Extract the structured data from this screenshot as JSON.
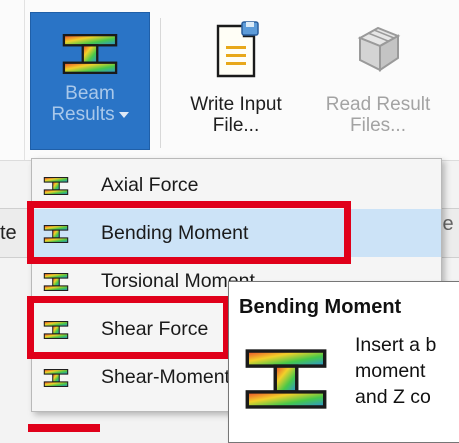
{
  "ribbon": {
    "beam_results": {
      "label": "Beam\nResults",
      "icon": "beam-results-icon"
    },
    "write_input": {
      "label": "Write Input\nFile...",
      "icon": "write-input-file-icon"
    },
    "read_result": {
      "label": "Read Result\nFiles...",
      "icon": "read-result-files-icon",
      "enabled": false
    }
  },
  "background": {
    "left_fragment": "te",
    "right_fragment": "le"
  },
  "menu": {
    "items": [
      {
        "label": "Axial Force",
        "icon": "beam-results-icon",
        "highlighted": false
      },
      {
        "label": "Bending Moment",
        "icon": "beam-results-icon",
        "highlighted": true
      },
      {
        "label": "Torsional Moment",
        "icon": "beam-results-icon",
        "highlighted": false
      },
      {
        "label": "Shear Force",
        "icon": "beam-results-icon",
        "highlighted": false
      },
      {
        "label": "Shear-Moment",
        "icon": "beam-results-icon",
        "highlighted": false
      }
    ]
  },
  "tooltip": {
    "title": "Bending Moment",
    "body": "Insert a b\nmoment\nand Z co",
    "icon": "beam-results-icon"
  },
  "colors": {
    "accent_blue": "#2a74c6",
    "highlight": "#cce3f7",
    "annotation_red": "#e0001a"
  }
}
